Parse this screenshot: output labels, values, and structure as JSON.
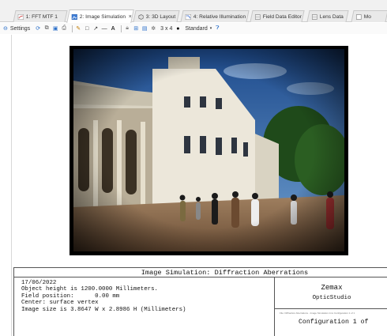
{
  "tabs": [
    {
      "label": "1: FFT MTF 1",
      "icon": "chart-icon",
      "closable": false
    },
    {
      "label": "2: Image Simulation",
      "icon": "image-icon",
      "closable": true,
      "active": true
    },
    {
      "label": "3: 3D Layout",
      "icon": "layout-3d-icon",
      "closable": false
    },
    {
      "label": "4: Relative Illumination",
      "icon": "chart-icon",
      "closable": false
    },
    {
      "label": "Field Data Editor",
      "icon": "editor-icon",
      "closable": false
    },
    {
      "label": "Lens Data",
      "icon": "editor-icon",
      "closable": false
    },
    {
      "label": "Mo",
      "icon": "editor-icon",
      "closable": false
    }
  ],
  "toolbar": {
    "settings_label": "Settings",
    "layout_label": "3 x 4",
    "standard_label": "Standard"
  },
  "caption": {
    "title": "Image Simulation: Diffraction Aberrations",
    "lines": [
      "17/06/2022",
      "Object height is 1200.0000 Millimeters.",
      "Field position:      0.00 mm",
      "Center: surface vertex",
      "Image size is 3.8647 W x 2.8986 H (Millimeters)"
    ],
    "brand_name": "Zemax",
    "brand_product": "OpticStudio",
    "fine_print": "File: Diffraction Aberrations - Image Simulation.zmx Configuration 1 of 1",
    "configuration": "Configuration 1 of"
  },
  "colors": {
    "accent": "#2a6fc9",
    "frame": "#000000",
    "sky": "#1f4a8a"
  }
}
